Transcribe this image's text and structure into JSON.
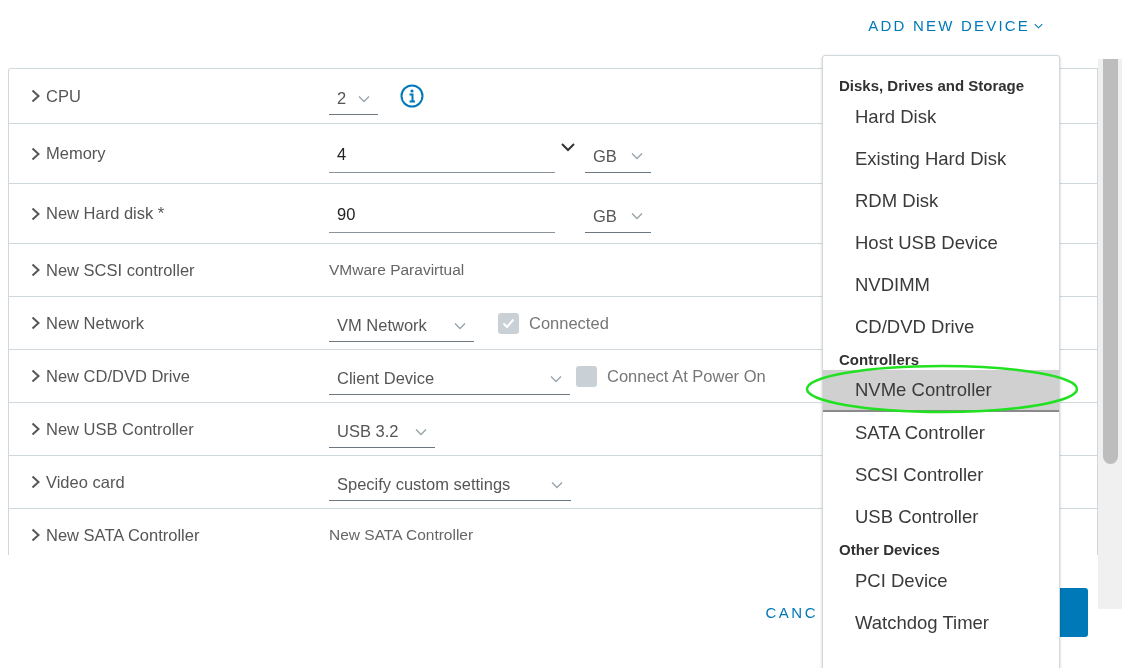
{
  "add_device_button": {
    "label": "ADD NEW DEVICE"
  },
  "hardware_rows": [
    {
      "kind": "dropdown",
      "label": "CPU",
      "value": "2",
      "info": true
    },
    {
      "kind": "number_unit",
      "label": "Memory",
      "value": "4",
      "unit": "GB",
      "expand_caret": true
    },
    {
      "kind": "number_unit",
      "label": "New Hard disk *",
      "value": "90",
      "unit": "GB",
      "expand_caret": false
    },
    {
      "kind": "text",
      "label": "New SCSI controller",
      "value": "VMware Paravirtual"
    },
    {
      "kind": "dropdown_check",
      "label": "New Network",
      "value": "VM Network",
      "check_label": "Connected",
      "checked": true
    },
    {
      "kind": "dropdown_check",
      "label": "New CD/DVD Drive",
      "value": "Client Device",
      "check_label": "Connect At Power On",
      "checked": false
    },
    {
      "kind": "dropdown",
      "label": "New USB Controller",
      "value": "USB 3.2",
      "info": false
    },
    {
      "kind": "dropdown",
      "label": "Video card",
      "value": "Specify custom settings",
      "info": false
    },
    {
      "kind": "text",
      "label": "New SATA Controller",
      "value": "New SATA Controller"
    }
  ],
  "footer": {
    "cancel_label": "CANC"
  },
  "device_menu": [
    {
      "header": "Disks, Drives and Storage",
      "items": [
        {
          "label": "Hard Disk",
          "selected": false,
          "circled": false
        },
        {
          "label": "Existing Hard Disk",
          "selected": false,
          "circled": false
        },
        {
          "label": "RDM Disk",
          "selected": false,
          "circled": false
        },
        {
          "label": "Host USB Device",
          "selected": false,
          "circled": false
        },
        {
          "label": "NVDIMM",
          "selected": false,
          "circled": false
        },
        {
          "label": "CD/DVD Drive",
          "selected": false,
          "circled": false
        }
      ]
    },
    {
      "header": "Controllers",
      "items": [
        {
          "label": "NVMe Controller",
          "selected": true,
          "circled": true
        },
        {
          "label": "SATA Controller",
          "selected": false,
          "circled": false
        },
        {
          "label": "SCSI Controller",
          "selected": false,
          "circled": false
        },
        {
          "label": "USB Controller",
          "selected": false,
          "circled": false
        }
      ]
    },
    {
      "header": "Other Devices",
      "items": [
        {
          "label": "PCI Device",
          "selected": false,
          "circled": false
        },
        {
          "label": "Watchdog Timer",
          "selected": false,
          "circled": false
        }
      ]
    }
  ]
}
